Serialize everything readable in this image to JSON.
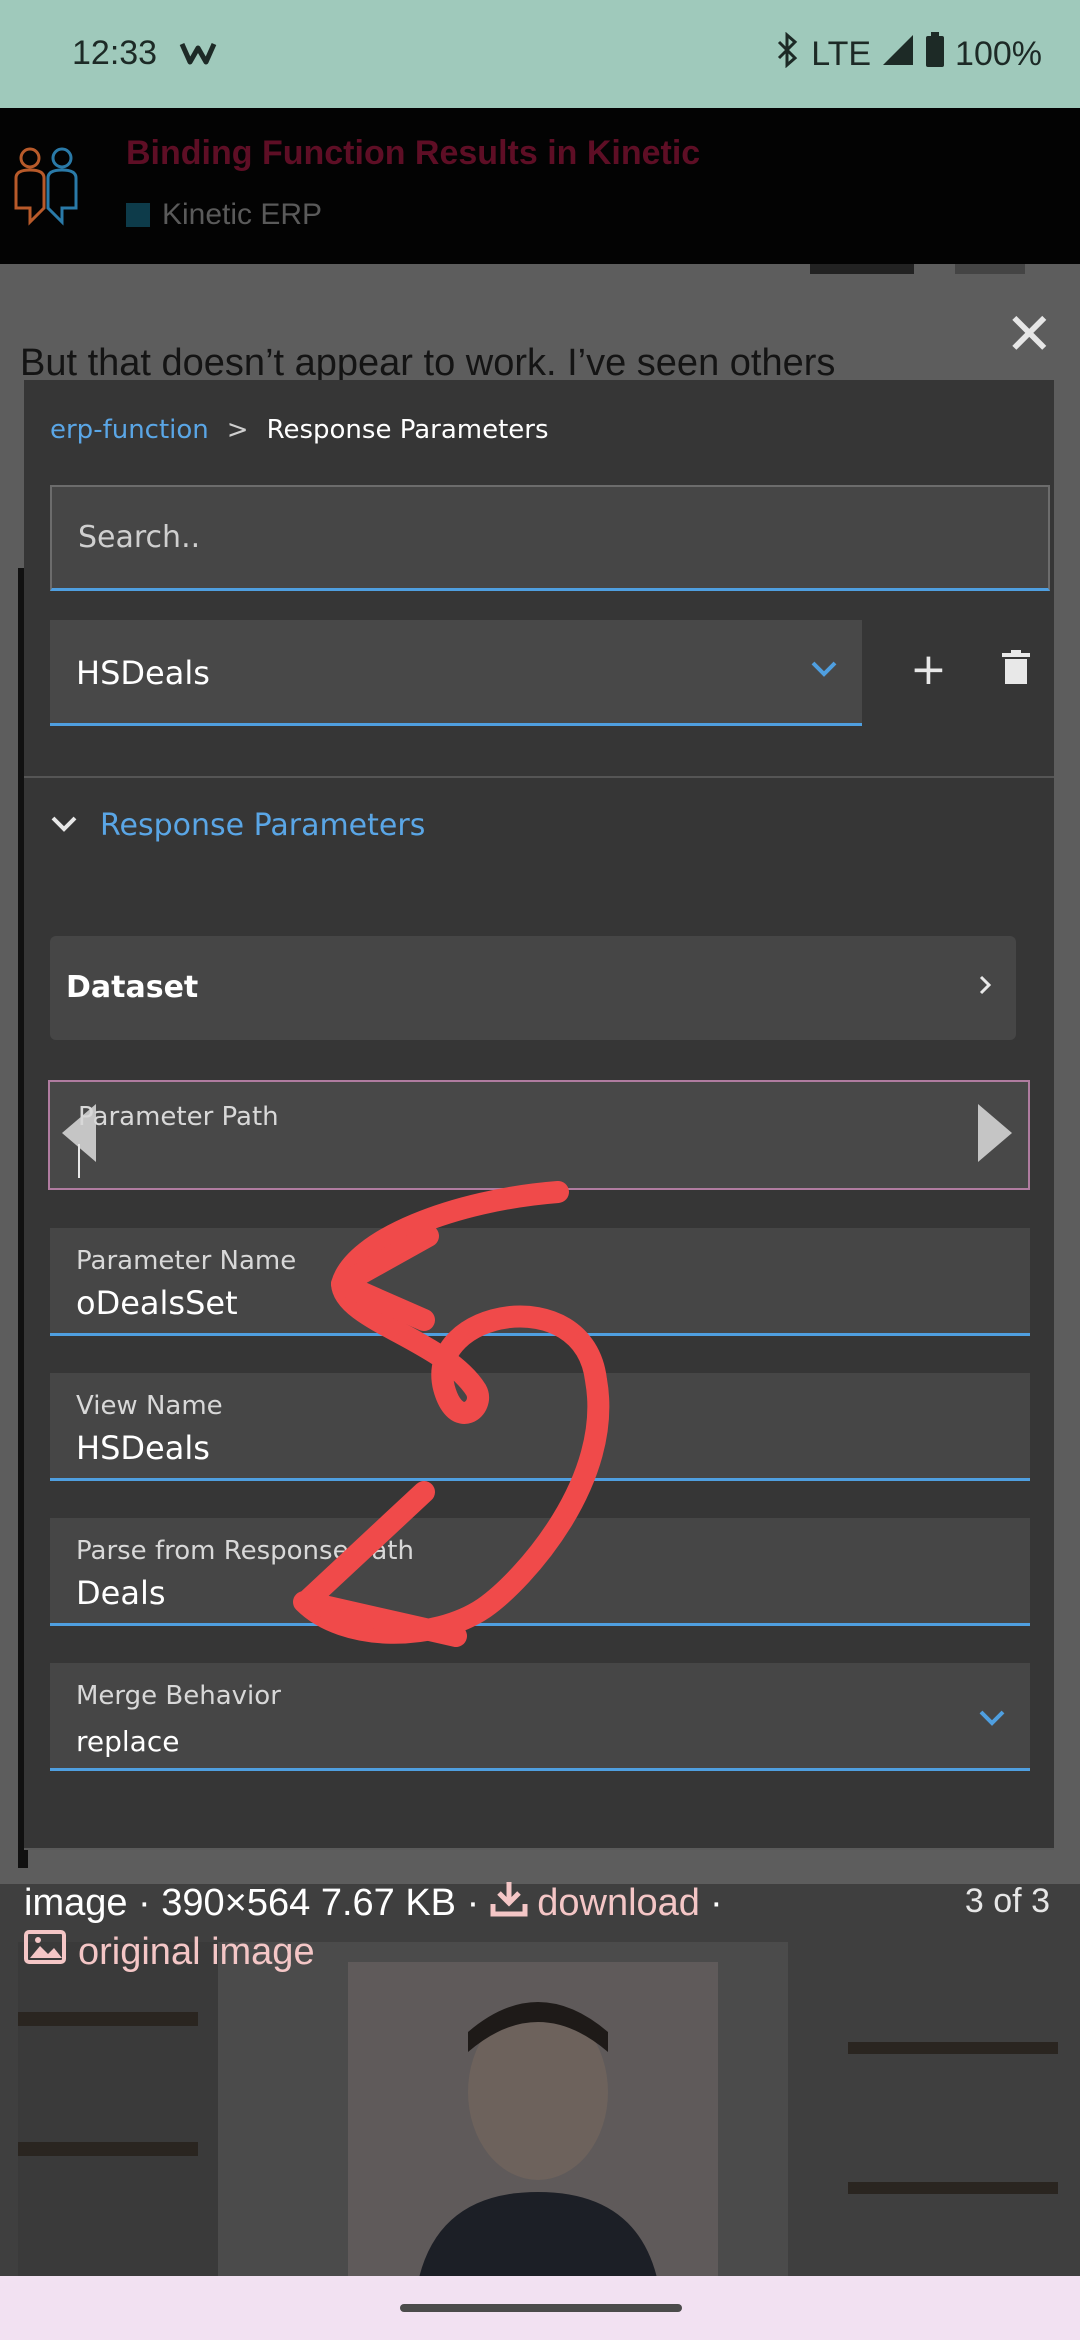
{
  "status_bar": {
    "time": "12:33",
    "network": "LTE",
    "battery": "100%"
  },
  "forum": {
    "title": "Binding Function Results in Kinetic",
    "category": "Kinetic ERP"
  },
  "background_text": "But that doesn’t appear to work. I’ve seen others",
  "panel": {
    "breadcrumb": {
      "link": "erp-function",
      "separator": ">",
      "current": "Response Parameters"
    },
    "search_placeholder": "Search..",
    "selected_view": "HSDeals",
    "section_title": "Response Parameters",
    "dataset_label": "Dataset",
    "fields": {
      "parameter_path": {
        "label": "Parameter Path",
        "value": ""
      },
      "parameter_name": {
        "label": "Parameter Name",
        "value": "oDealsSet"
      },
      "view_name": {
        "label": "View Name",
        "value": "HSDeals"
      },
      "parse_from_response_path": {
        "label": "Parse from Response Path",
        "value": "Deals"
      },
      "merge_behavior": {
        "label": "Merge Behavior",
        "value": "replace"
      }
    }
  },
  "caption": {
    "info": "image · 390×564 7.67 KB ·",
    "download": "download",
    "trailing": "·",
    "counter": "3 of 3",
    "original": "original image"
  },
  "colors": {
    "status_bar": "#9fc9bb",
    "accent_blue": "#4f9fe0",
    "link_blue": "#5aa6e6",
    "annotation_red": "#f04a4a",
    "forum_title": "#5e0e25",
    "nav_bar": "#f2e1f2"
  },
  "icons": [
    "bluetooth-icon",
    "signal-icon",
    "battery-icon",
    "webtoon-icon",
    "close-icon",
    "chevron-down-icon",
    "plus-icon",
    "trash-icon",
    "chevron-right-icon",
    "arrow-left-icon",
    "arrow-right-icon",
    "download-icon",
    "image-icon"
  ]
}
